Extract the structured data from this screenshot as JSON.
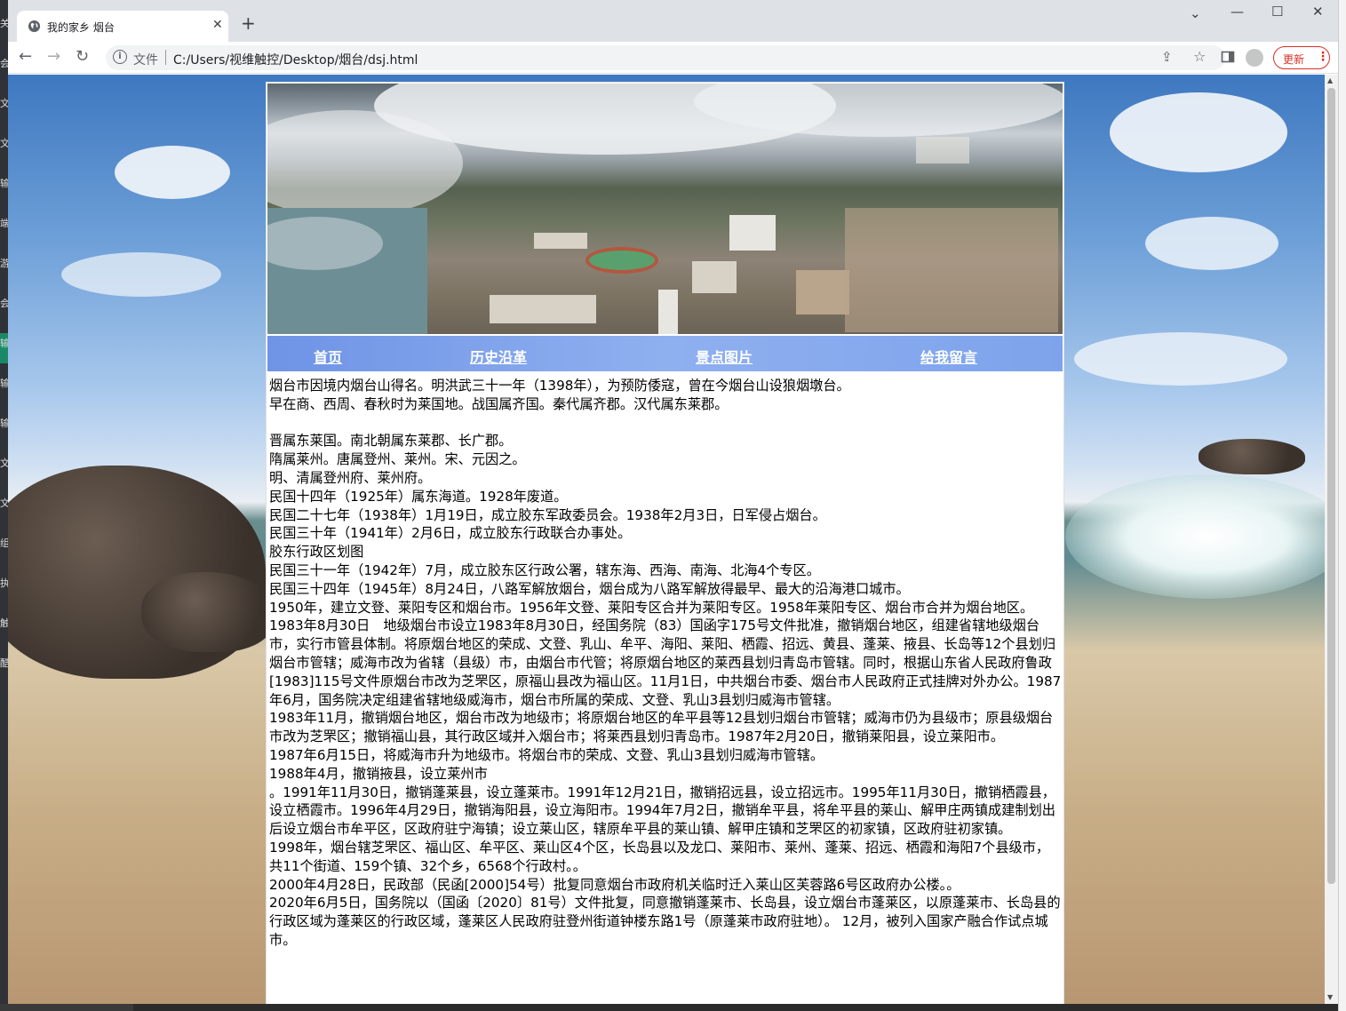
{
  "browser": {
    "tab_title": "我的家乡 烟台",
    "tab_close": "✕",
    "new_tab": "+",
    "scheme_label": "文件",
    "url": "C:/Users/视维触控/Desktop/烟台/dsj.html",
    "update_label": "更新",
    "menu_dots": "⋮",
    "controls": {
      "minimize": "—",
      "maximize": "☐",
      "close": "✕",
      "chevron": "⌄"
    },
    "nav": {
      "back": "←",
      "forward": "→",
      "reload": "↻"
    }
  },
  "desktop_left_glyphs": [
    "关",
    "会",
    "文",
    "文",
    "输",
    "端",
    "游",
    "会",
    "输",
    "输",
    "输",
    "文",
    "文",
    "组",
    "执",
    "触",
    "酷"
  ],
  "navbar": {
    "items": [
      {
        "label": "首页"
      },
      {
        "label": "历史沿革"
      },
      {
        "label": "景点图片"
      },
      {
        "label": "给我留言"
      }
    ]
  },
  "article": {
    "lines": [
      "烟台市因境内烟台山得名。明洪武三十一年（1398年），为预防倭寇，曾在今烟台山设狼烟墩台。",
      "早在商、西周、春秋时为莱国地。战国属齐国。秦代属齐郡。汉代属东莱郡。",
      "",
      "晋属东莱国。南北朝属东莱郡、长广郡。",
      "隋属莱州。唐属登州、莱州。宋、元因之。",
      "明、清属登州府、莱州府。",
      "民国十四年（1925年）属东海道。1928年废道。",
      "民国二十七年（1938年）1月19日，成立胶东军政委员会。1938年2月3日，日军侵占烟台。",
      "民国三十年（1941年）2月6日，成立胶东行政联合办事处。",
      "胶东行政区划图",
      "民国三十一年（1942年）7月，成立胶东区行政公署，辖东海、西海、南海、北海4个专区。",
      "民国三十四年（1945年）8月24日，八路军解放烟台，烟台成为八路军解放得最早、最大的沿海港口城市。",
      "1950年，建立文登、莱阳专区和烟台市。1956年文登、莱阳专区合并为莱阳专区。1958年莱阳专区、烟台市合并为烟台地区。",
      "1983年8月30日　地级烟台市设立1983年8月30日，经国务院（83）国函字175号文件批准，撤销烟台地区，组建省辖地级烟台市，实行市管县体制。将原烟台地区的荣成、文登、乳山、牟平、海阳、莱阳、栖霞、招远、黄县、蓬莱、掖县、长岛等12个县划归烟台市管辖；威海市改为省辖（县级）市，由烟台市代管；将原烟台地区的莱西县划归青岛市管辖。同时，根据山东省人民政府鲁政[1983]115号文件原烟台市改为芝罘区，原福山县改为福山区。11月1日，中共烟台市委、烟台市人民政府正式挂牌对外办公。1987年6月，国务院决定组建省辖地级威海市，烟台市所属的荣成、文登、乳山3县划归威海市管辖。",
      "1983年11月，撤销烟台地区，烟台市改为地级市；将原烟台地区的牟平县等12县划归烟台市管辖；威海市仍为县级市；原县级烟台市改为芝罘区；撤销福山县，其行政区域并入烟台市；将莱西县划归青岛市。1987年2月20日，撤销莱阳县，设立莱阳市。",
      "1987年6月15日，将威海市升为地级市。将烟台市的荣成、文登、乳山3县划归威海市管辖。",
      "1988年4月，撤销掖县，设立莱州市",
      "。1991年11月30日，撤销蓬莱县，设立蓬莱市。1991年12月21日，撤销招远县，设立招远市。1995年11月30日，撤销栖霞县，设立栖霞市。1996年4月29日，撤销海阳县，设立海阳市。1994年7月2日，撤销牟平县，将牟平县的莱山、解甲庄两镇成建制划出后设立烟台市牟平区，区政府驻宁海镇；设立莱山区，辖原牟平县的莱山镇、解甲庄镇和芝罘区的初家镇，区政府驻初家镇。",
      "1998年，烟台辖芝罘区、福山区、牟平区、莱山区4个区，长岛县以及龙口、莱阳市、莱州、蓬莱、招远、栖霞和海阳7个县级市，共11个街道、159个镇、32个乡，6568个行政村。。",
      "2000年4月28日，民政部（民函[2000]54号）批复同意烟台市政府机关临时迁入莱山区芙蓉路6号区政府办公楼。。",
      "2020年6月5日，国务院以（国函〔2020〕81号）文件批复，同意撤销蓬莱市、长岛县，设立烟台市蓬莱区，以原蓬莱市、长岛县的行政区域为蓬莱区的行政区域，蓬莱区人民政府驻登州街道钟楼东路1号（原蓬莱市政府驻地）。 12月，被列入国家产融合作试点城市。"
    ]
  }
}
